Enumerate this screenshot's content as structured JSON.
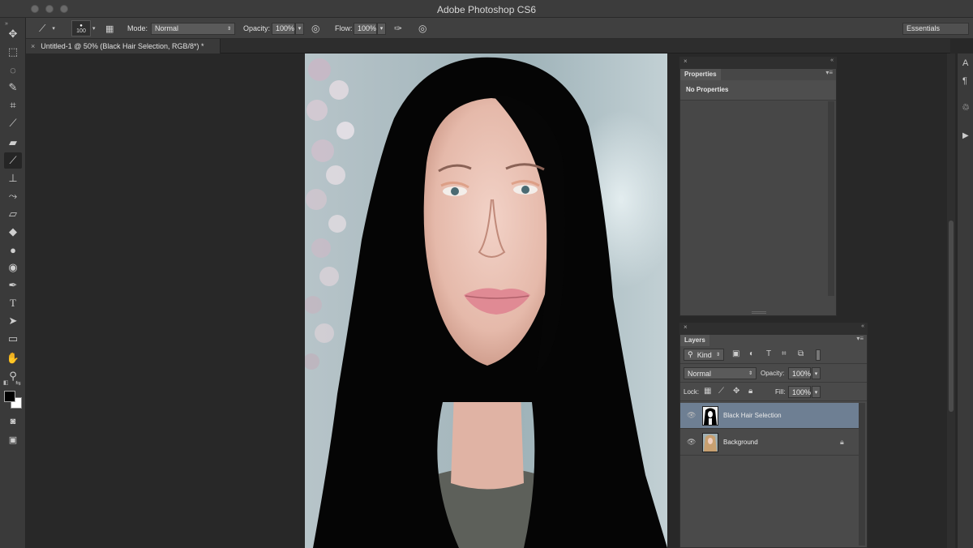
{
  "window": {
    "title": "Adobe Photoshop CS6"
  },
  "options": {
    "brush_size": "100",
    "mode_label": "Mode:",
    "mode_value": "Normal",
    "opacity_label": "Opacity:",
    "opacity_value": "100%",
    "flow_label": "Flow:",
    "flow_value": "100%",
    "workspace": "Essentials"
  },
  "document": {
    "tab_label": "Untitled-1 @ 50% (Black Hair Selection, RGB/8*) *"
  },
  "properties": {
    "tab": "Properties",
    "message": "No Properties"
  },
  "layers": {
    "tab": "Layers",
    "filter_kind": "Kind",
    "blend_mode": "Normal",
    "opacity_label": "Opacity:",
    "opacity_value": "100%",
    "lock_label": "Lock:",
    "fill_label": "Fill:",
    "fill_value": "100%",
    "items": [
      {
        "name": "Black Hair Selection",
        "selected": true,
        "locked": false
      },
      {
        "name": "Background",
        "selected": false,
        "locked": true
      }
    ]
  },
  "icons": {
    "tools": [
      "move-icon",
      "marquee-icon",
      "lasso-icon",
      "quick-select-icon",
      "crop-icon",
      "eyedropper-icon",
      "healing-icon",
      "brush-icon",
      "stamp-icon",
      "history-brush-icon",
      "eraser-icon",
      "paint-bucket-icon",
      "blur-icon",
      "dodge-icon",
      "pen-icon",
      "type-icon",
      "path-select-icon",
      "rectangle-icon",
      "hand-icon",
      "zoom-icon"
    ]
  },
  "colors": {
    "accent": "#6e7f93",
    "panel": "#4a4a4a",
    "background": "#282828"
  }
}
